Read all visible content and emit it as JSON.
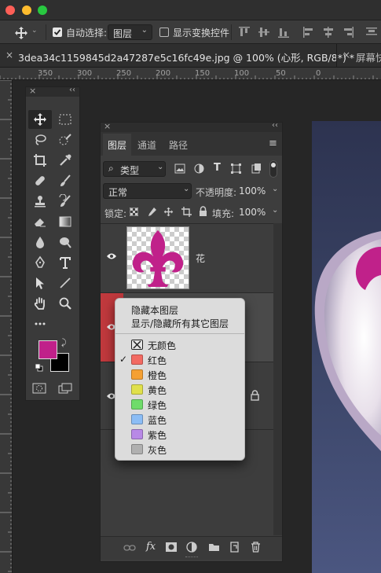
{
  "options_bar": {
    "auto_select_label": "自动选择:",
    "auto_select_checked": true,
    "auto_select_target": "图层",
    "show_transform_label": "显示变换控件",
    "show_transform_checked": false
  },
  "tabs": [
    {
      "label": "3dea34c1159845d2a47287e5c16fc49e.jpg @ 100% (心形, RGB/8*) *",
      "active": true
    },
    {
      "label": "屏幕快",
      "active": false
    }
  ],
  "ruler": {
    "h_ticks": [
      "350",
      "300",
      "250",
      "200",
      "150",
      "100",
      "50",
      "0"
    ]
  },
  "layers_panel": {
    "tabs": [
      "图层",
      "通道",
      "路径"
    ],
    "active_tab": "图层",
    "filter_kind": "类型",
    "blend_mode": "正常",
    "opacity_label": "不透明度:",
    "opacity_value": "100%",
    "lock_label": "锁定:",
    "fill_label": "填充:",
    "fill_value": "100%",
    "layers": [
      {
        "name": "花",
        "visible": true,
        "color_label": "none"
      },
      {
        "name": "",
        "visible": true,
        "color_label": "red"
      },
      {
        "name": "",
        "visible": true,
        "color_label": "none",
        "locked": true
      }
    ]
  },
  "context_menu": {
    "top_items": [
      "隐藏本图层",
      "显示/隐藏所有其它图层"
    ],
    "colors": [
      {
        "label": "无颜色",
        "color": "none",
        "checked": false
      },
      {
        "label": "红色",
        "color": "#f26a62",
        "checked": true
      },
      {
        "label": "橙色",
        "color": "#f5a033",
        "checked": false
      },
      {
        "label": "黄色",
        "color": "#e0e04c",
        "checked": false
      },
      {
        "label": "绿色",
        "color": "#6fdc6a",
        "checked": false
      },
      {
        "label": "蓝色",
        "color": "#8cbdf5",
        "checked": false
      },
      {
        "label": "紫色",
        "color": "#b889e6",
        "checked": false
      },
      {
        "label": "灰色",
        "color": "#b0b0b0",
        "checked": false
      }
    ]
  },
  "colors": {
    "foreground": "#c0218a",
    "background": "#000000",
    "accent_red": "#c0393d",
    "fleur": "#c0218a"
  }
}
